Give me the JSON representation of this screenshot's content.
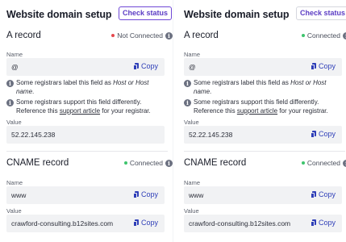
{
  "left": {
    "header": {
      "title": "Website domain setup",
      "button": "Check status"
    },
    "a_record": {
      "title": "A record",
      "status": "Not Connected",
      "name_label": "Name",
      "name_value": "@",
      "copy_label": "Copy",
      "note1_prefix": "Some registrars label this field as ",
      "note1_em": "Host or Host name",
      "note1_suffix": ".",
      "note2_prefix": "Some registrars support this field differently. Reference this ",
      "note2_link": "support article",
      "note2_suffix": " for your registrar.",
      "value_label": "Value",
      "value_value": "52.22.145.238"
    },
    "cname_record": {
      "title": "CNAME record",
      "status": "Connected",
      "name_label": "Name",
      "name_value": "www",
      "value_label": "Value",
      "value_value": "crawford-consulting.b12sites.com",
      "copy_label": "Copy"
    }
  },
  "right": {
    "header": {
      "title": "Website domain setup",
      "button": "Check status"
    },
    "a_record": {
      "title": "A record",
      "status": "Connected",
      "name_label": "Name",
      "name_value": "@",
      "copy_label": "Copy",
      "note1_prefix": "Some registrars label this field as ",
      "note1_em": "Host or Host name",
      "note1_suffix": ".",
      "note2_prefix": "Some registrars support this field differently. Reference this ",
      "note2_link": "support article",
      "note2_suffix": " for your registrar.",
      "value_label": "Value",
      "value_value": "52.22.145.238"
    },
    "cname_record": {
      "title": "CNAME record",
      "status": "Connected",
      "name_label": "Name",
      "name_value": "www",
      "value_label": "Value",
      "value_value": "crawford-consulting.b12sites.com",
      "copy_label": "Copy"
    }
  },
  "colors": {
    "accent": "#5b3cc4",
    "link": "#2f3fb8",
    "connected": "#3ec46d",
    "not_connected": "#e5484d"
  },
  "icons": {
    "info": "info-icon",
    "copy": "copy-icon",
    "status": "status-dot-icon"
  }
}
